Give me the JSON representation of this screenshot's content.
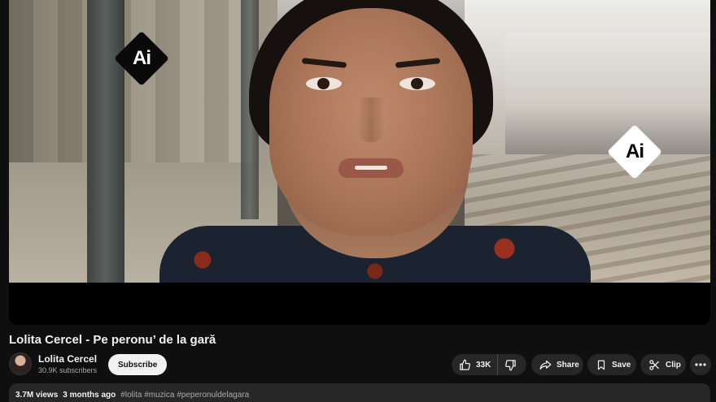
{
  "video": {
    "title": "Lolita Cercel - Pe peronu’ de la gară",
    "watermark_text": "Ai"
  },
  "channel": {
    "name": "Lolita Cercel",
    "subscribers": "30.9K subscribers",
    "subscribe_label": "Subscribe"
  },
  "actions": {
    "like_count": "33K",
    "share_label": "Share",
    "save_label": "Save",
    "clip_label": "Clip"
  },
  "description": {
    "views": "3.7M views",
    "age": "3 months ago",
    "hashtags": "#lolita #muzica #peperonuldelagara"
  },
  "colors": {
    "background": "#0f0f0f",
    "pill": "#272727",
    "subscribe_bg": "#f1f1f1",
    "secondary_text": "#aaaaaa"
  },
  "icons": [
    "thumbs-up-icon",
    "thumbs-down-icon",
    "share-icon",
    "save-icon",
    "scissors-icon",
    "more-icon"
  ]
}
